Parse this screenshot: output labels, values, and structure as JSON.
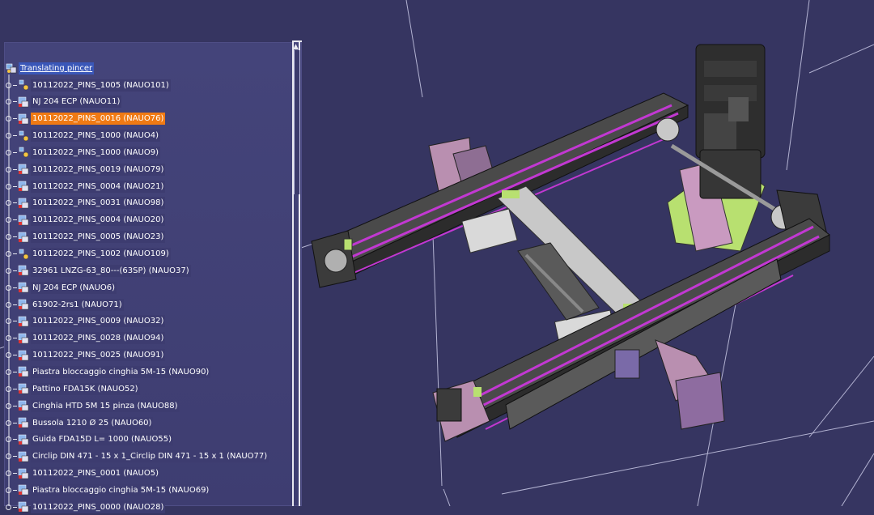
{
  "tree": {
    "root": {
      "label": "Translating pincer",
      "icon": "product-root-icon"
    },
    "nodes": [
      {
        "label": "10112022_PINS_1005 (NAUO101)",
        "icon": "product-icon"
      },
      {
        "label": "NJ 204 ECP (NAUO11)",
        "icon": "part-icon"
      },
      {
        "label": "10112022_PINS_0016 (NAUO76)",
        "icon": "part-icon",
        "selected": true
      },
      {
        "label": "10112022_PINS_1000 (NAUO4)",
        "icon": "product-icon"
      },
      {
        "label": "10112022_PINS_1000 (NAUO9)",
        "icon": "product-icon"
      },
      {
        "label": "10112022_PINS_0019 (NAUO79)",
        "icon": "part-icon"
      },
      {
        "label": "10112022_PINS_0004 (NAUO21)",
        "icon": "part-icon"
      },
      {
        "label": "10112022_PINS_0031 (NAUO98)",
        "icon": "part-icon"
      },
      {
        "label": "10112022_PINS_0004 (NAUO20)",
        "icon": "part-icon"
      },
      {
        "label": "10112022_PINS_0005 (NAUO23)",
        "icon": "part-icon"
      },
      {
        "label": "10112022_PINS_1002 (NAUO109)",
        "icon": "product-icon"
      },
      {
        "label": "32961 LNZG-63_80---(63SP) (NAUO37)",
        "icon": "part-icon"
      },
      {
        "label": "NJ 204 ECP (NAUO6)",
        "icon": "part-icon"
      },
      {
        "label": "61902-2rs1 (NAUO71)",
        "icon": "part-icon"
      },
      {
        "label": "10112022_PINS_0009 (NAUO32)",
        "icon": "part-icon"
      },
      {
        "label": "10112022_PINS_0028 (NAUO94)",
        "icon": "part-icon"
      },
      {
        "label": "10112022_PINS_0025 (NAUO91)",
        "icon": "part-icon"
      },
      {
        "label": "Piastra bloccaggio cinghia 5M-15 (NAUO90)",
        "icon": "part-icon"
      },
      {
        "label": "Pattino FDA15K (NAUO52)",
        "icon": "part-icon"
      },
      {
        "label": "Cinghia HTD 5M 15 pinza (NAUO88)",
        "icon": "part-icon"
      },
      {
        "label": "Bussola 1210 Ø 25 (NAUO60)",
        "icon": "part-icon"
      },
      {
        "label": "Guida FDA15D L= 1000 (NAUO55)",
        "icon": "part-icon"
      },
      {
        "label": "Circlip DIN 471 - 15 x 1_Circlip DIN 471 - 15 x 1 (NAUO77)",
        "icon": "part-icon"
      },
      {
        "label": "10112022_PINS_0001 (NAUO5)",
        "icon": "part-icon"
      },
      {
        "label": "Piastra bloccaggio cinghia 5M-15 (NAUO69)",
        "icon": "part-icon"
      },
      {
        "label": "10112022_PINS_0000 (NAUO28)",
        "icon": "part-icon"
      }
    ]
  },
  "colors": {
    "background": "#363561",
    "panel": "#44447a",
    "selection": "#f07a14",
    "root_highlight": "#3a57b8",
    "belt": "#c238d2",
    "frame": "#3a3a3a",
    "plate": "#b98fb0",
    "green_part": "#b8e070"
  }
}
